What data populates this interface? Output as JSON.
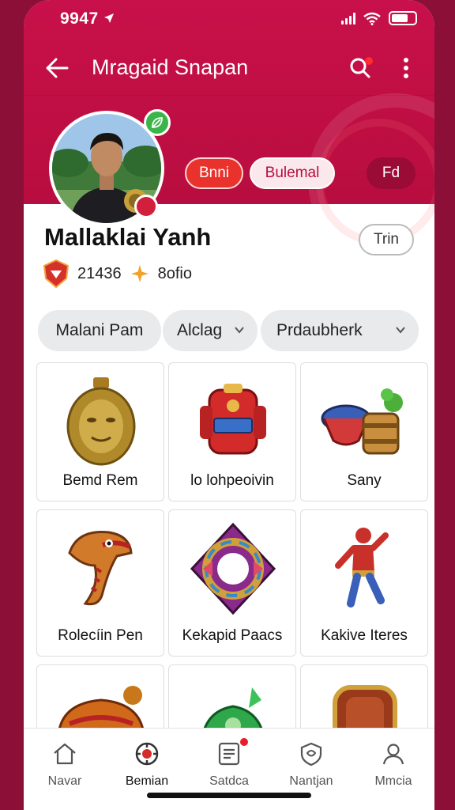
{
  "status": {
    "time": "9947"
  },
  "app_bar": {
    "title": "Mragaid Snapan"
  },
  "profile": {
    "name": "Mallaklai Yanh",
    "follow_label": "Trin",
    "stat_value": "21436",
    "stat_label": "8ofio",
    "pills": [
      "Bnni",
      "Bulemal",
      "Fd"
    ]
  },
  "filters": {
    "chip1": "Malani Pam",
    "chip2": "Alclag",
    "chip3": "Prdaubherk"
  },
  "items": [
    {
      "name": "Bemd Rem",
      "icon": "golden-mask-amulet-icon"
    },
    {
      "name": "lo lohpeoivin",
      "icon": "red-robot-armor-icon"
    },
    {
      "name": "Sany",
      "icon": "barrel-potion-icon"
    },
    {
      "name": "Rolecíin Pen",
      "icon": "dragon-head-icon"
    },
    {
      "name": "Kekapid Paacs",
      "icon": "gem-ring-icon"
    },
    {
      "name": "Kakive Iteres",
      "icon": "red-hero-figure-icon"
    },
    {
      "name": "",
      "icon": "orange-helmet-icon"
    },
    {
      "name": "",
      "icon": "green-armor-icon"
    },
    {
      "name": "",
      "icon": "bronze-shield-icon"
    }
  ],
  "bottom_nav": [
    {
      "label": "Navar",
      "icon": "home-icon"
    },
    {
      "label": "Bemian",
      "icon": "camera-icon"
    },
    {
      "label": "Satdca",
      "icon": "document-icon"
    },
    {
      "label": "Nantjan",
      "icon": "shield-icon"
    },
    {
      "label": "Mmcia",
      "icon": "profile-icon"
    }
  ],
  "colors": {
    "brand": "#c8104a",
    "accent_red": "#e8322b",
    "online_green": "#3bb54a"
  }
}
